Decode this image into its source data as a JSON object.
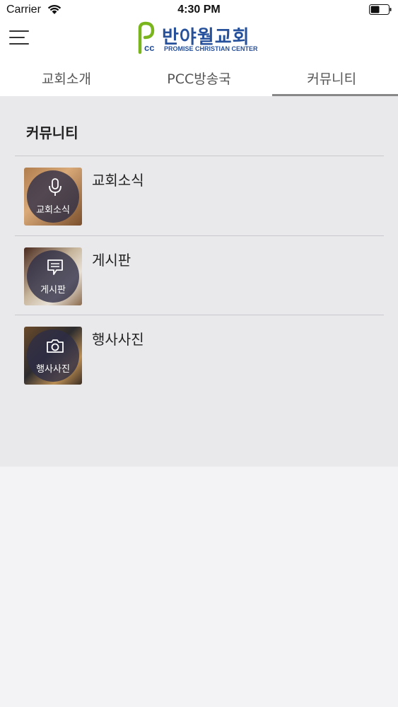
{
  "status_bar": {
    "carrier": "Carrier",
    "time": "4:30 PM",
    "battery_level": 0.5
  },
  "header": {
    "logo_title": "반야월교회",
    "logo_subtitle": "PROMISE CHRISTIAN CENTER",
    "logo_mark": "PCC",
    "brand_color": "#27519b",
    "accent_color": "#7ab51d"
  },
  "tabs": [
    {
      "label": "교회소개",
      "active": false
    },
    {
      "label": "PCC방송국",
      "active": false
    },
    {
      "label": "커뮤니티",
      "active": true
    }
  ],
  "section": {
    "title": "커뮤니티"
  },
  "items": [
    {
      "title": "교회소식",
      "thumb_label": "교회소식",
      "icon": "microphone-icon"
    },
    {
      "title": "게시판",
      "thumb_label": "게시판",
      "icon": "comment-icon"
    },
    {
      "title": "행사사진",
      "thumb_label": "행사사진",
      "icon": "camera-icon"
    }
  ]
}
